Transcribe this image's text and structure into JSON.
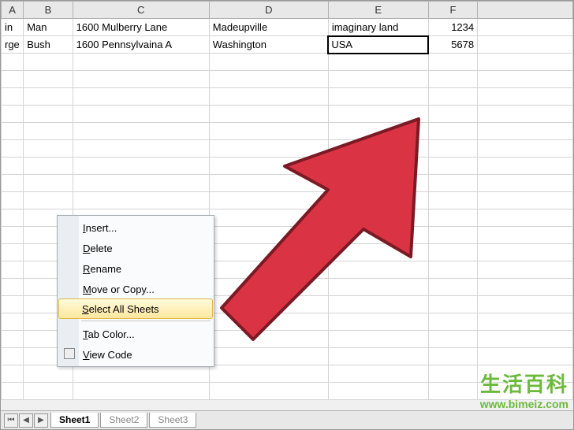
{
  "columns": [
    "A",
    "B",
    "C",
    "D",
    "E",
    "F"
  ],
  "rows": [
    {
      "A": "in",
      "B": "Man",
      "C": "1600 Mulberry Lane",
      "D": "Madeupville",
      "E": "imaginary land",
      "F": "1234"
    },
    {
      "A": "rge",
      "B": "Bush",
      "C": "1600 Pennsylvaina A",
      "D": "Washington",
      "E": "USA",
      "F": "5678"
    }
  ],
  "selected_cell": "E2",
  "context_menu": {
    "items": [
      {
        "label": "Insert...",
        "key": "I"
      },
      {
        "label": "Delete",
        "key": "D"
      },
      {
        "label": "Rename",
        "key": "R"
      },
      {
        "label": "Move or Copy...",
        "key": "M"
      },
      {
        "label": "Select All Sheets",
        "key": "S",
        "highlighted": true
      },
      {
        "separator": true
      },
      {
        "label": "Tab Color...",
        "key": "T"
      },
      {
        "label": "View Code",
        "key": "V",
        "icon": "view-code-icon"
      }
    ]
  },
  "sheet_tabs": {
    "active": "Sheet1",
    "tabs": [
      "Sheet1",
      "Sheet2",
      "Sheet3"
    ]
  },
  "watermark": {
    "title": "生活百科",
    "url": "www.bimeiz.com"
  }
}
